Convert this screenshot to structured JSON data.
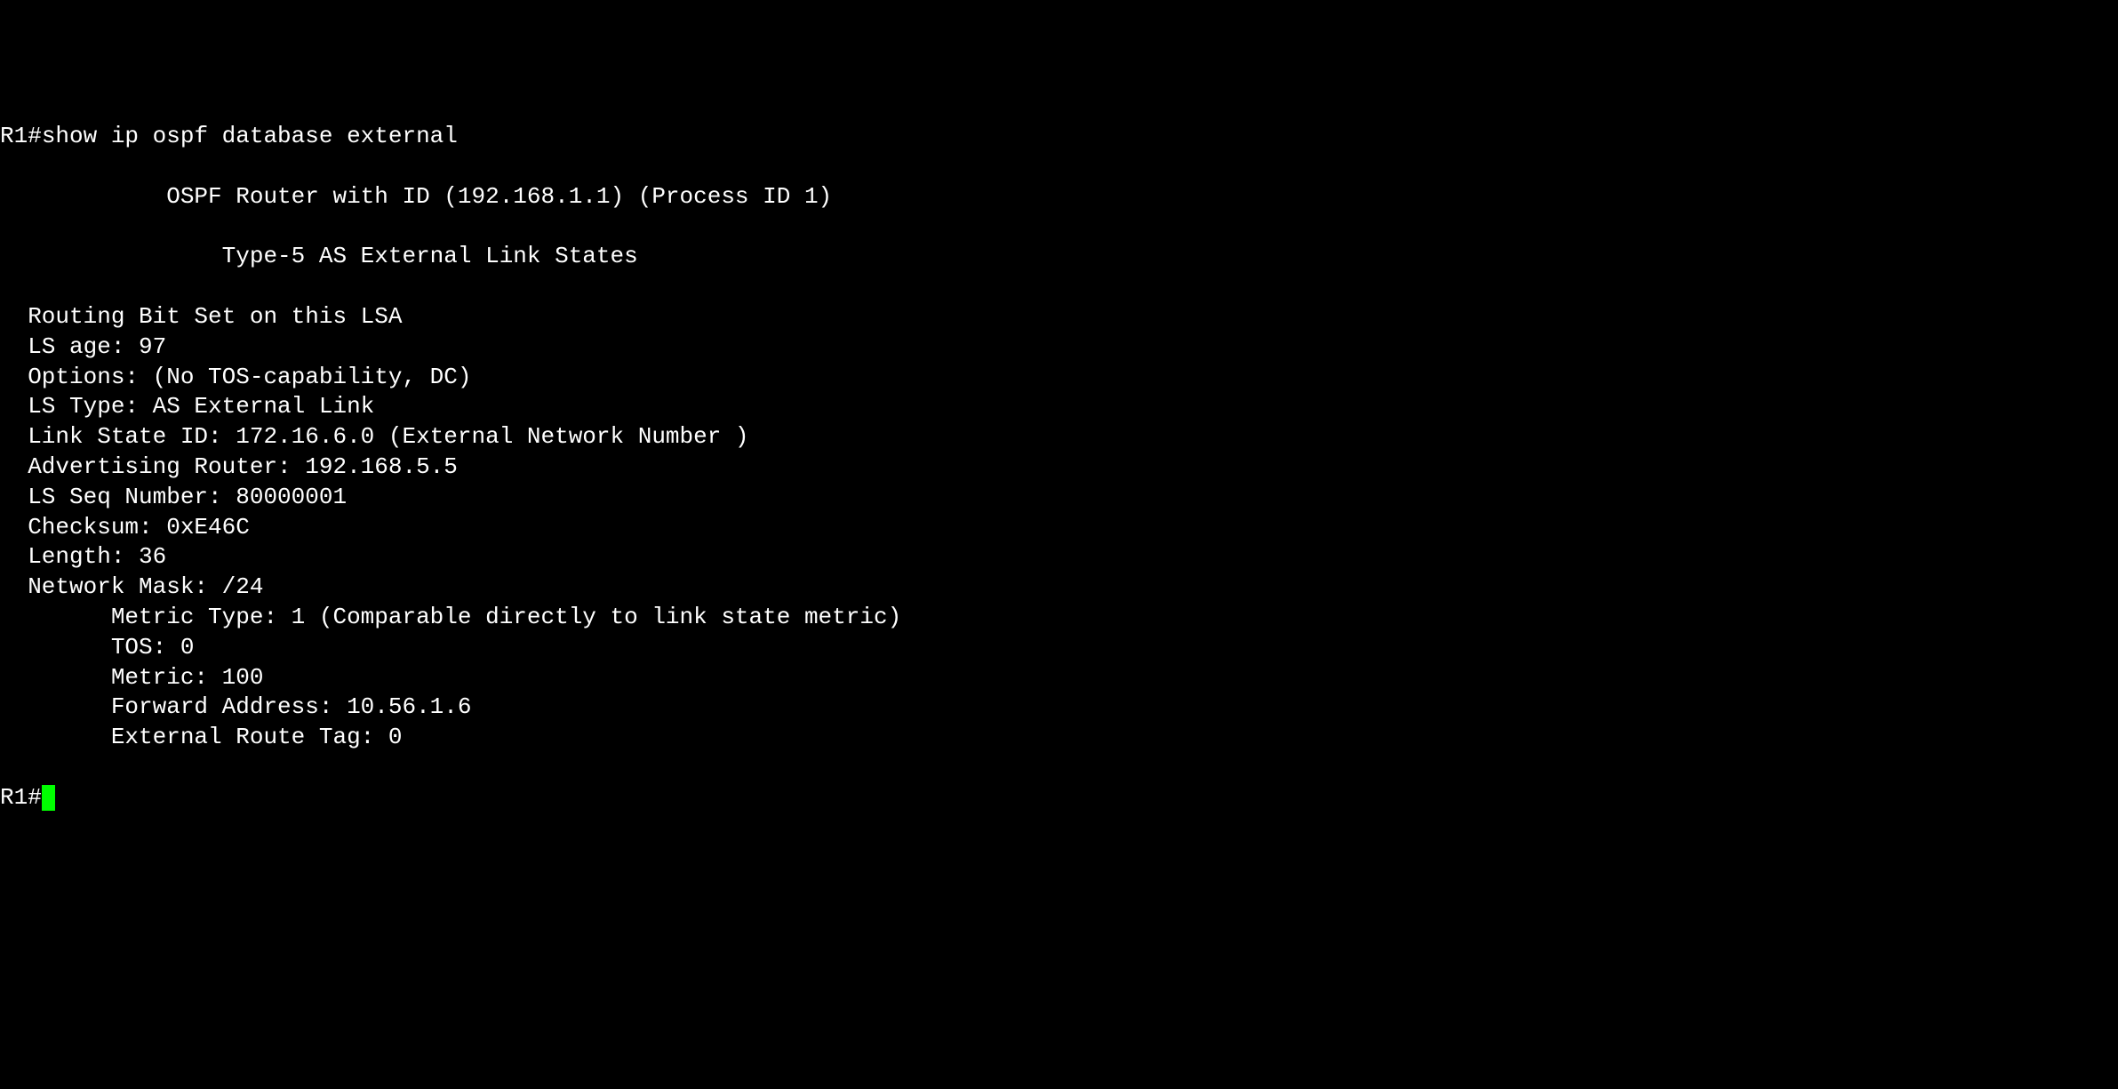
{
  "terminal": {
    "prompt": "R1#",
    "command": "show ip ospf database external",
    "blank": "",
    "header_line": "            OSPF Router with ID (192.168.1.1) (Process ID 1)",
    "section_line": "                Type-5 AS External Link States",
    "lsa": {
      "routing_bit": "  Routing Bit Set on this LSA",
      "ls_age": "  LS age: 97",
      "options": "  Options: (No TOS-capability, DC)",
      "ls_type": "  LS Type: AS External Link",
      "link_state_id": "  Link State ID: 172.16.6.0 (External Network Number )",
      "adv_router": "  Advertising Router: 192.168.5.5",
      "ls_seq": "  LS Seq Number: 80000001",
      "checksum": "  Checksum: 0xE46C",
      "length": "  Length: 36",
      "network_mask": "  Network Mask: /24",
      "metric_type": "        Metric Type: 1 (Comparable directly to link state metric)",
      "tos": "        TOS: 0",
      "metric": "        Metric: 100",
      "forward_address": "        Forward Address: 10.56.1.6",
      "external_route_tag": "        External Route Tag: 0"
    },
    "final_prompt": "R1#"
  }
}
